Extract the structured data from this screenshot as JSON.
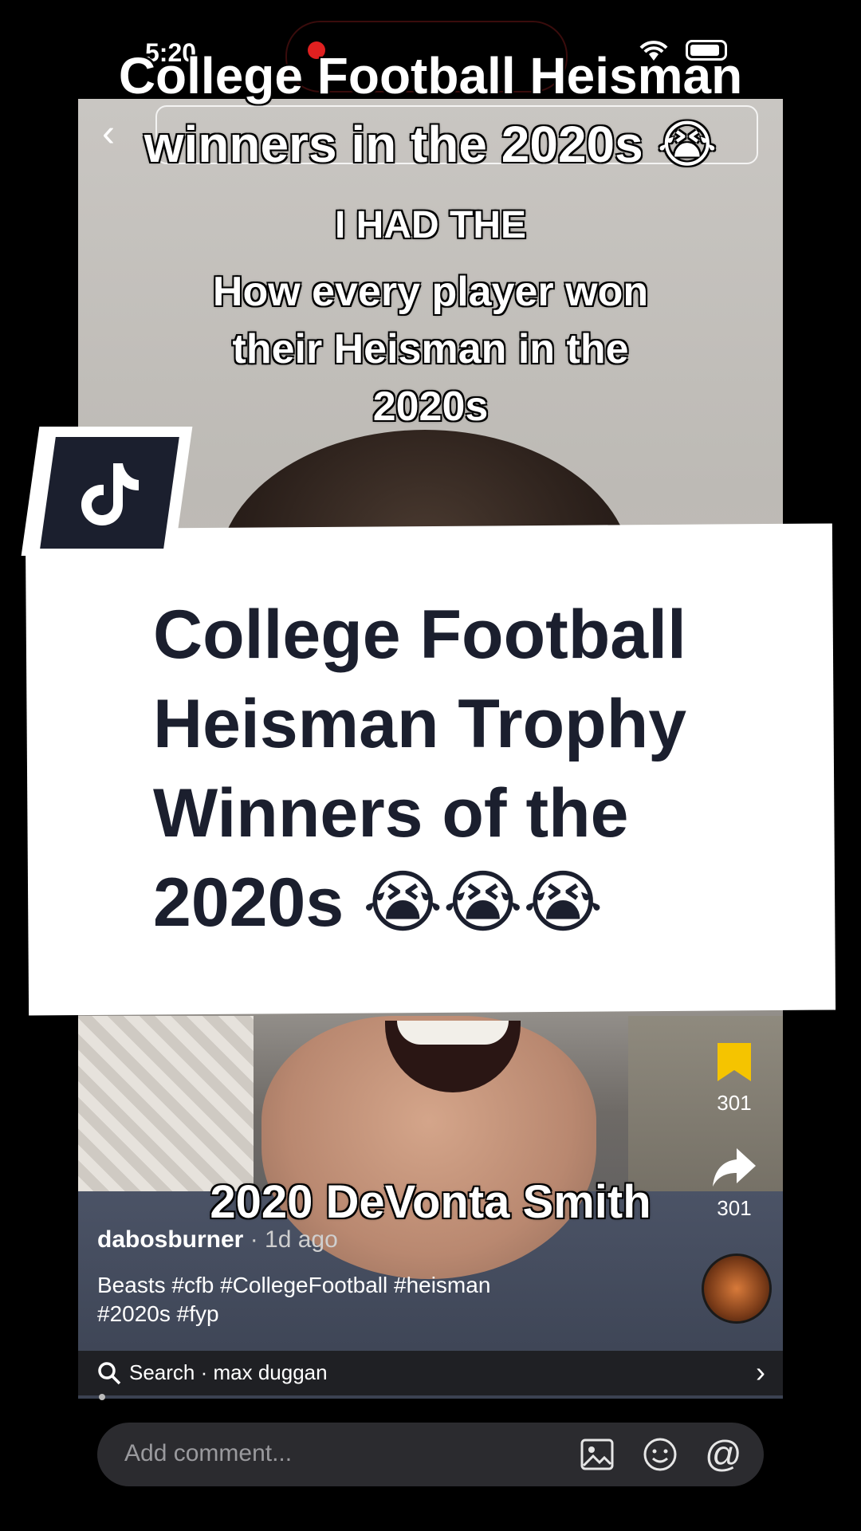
{
  "status_bar": {
    "time": "5:20"
  },
  "top_title": {
    "line1": "College Football Heisman",
    "line2": "winners in the 2020s 😭"
  },
  "video_overlay": {
    "line1": "I HAD THE",
    "line2": "How every player won",
    "line3": "their Heisman in the",
    "line4": "2020s",
    "bottom_caption": "2020 DeVonta Smith"
  },
  "card": {
    "title_line1": "College Football",
    "title_line2": "Heisman Trophy",
    "title_line3": "Winners of the",
    "title_line4": "2020s 😭😭😭"
  },
  "actions": {
    "bookmark_count": "301",
    "share_count": "301"
  },
  "post": {
    "username": "dabosburner",
    "time": "· 1d ago",
    "caption_line1": "Beasts #cfb #CollegeFootball #heisman",
    "caption_line2": "#2020s #fyp"
  },
  "search": {
    "label": "Search · max duggan"
  },
  "comment": {
    "placeholder": "Add comment..."
  },
  "colors": {
    "accent": "#f5c400",
    "card_text": "#1b1f2e"
  }
}
